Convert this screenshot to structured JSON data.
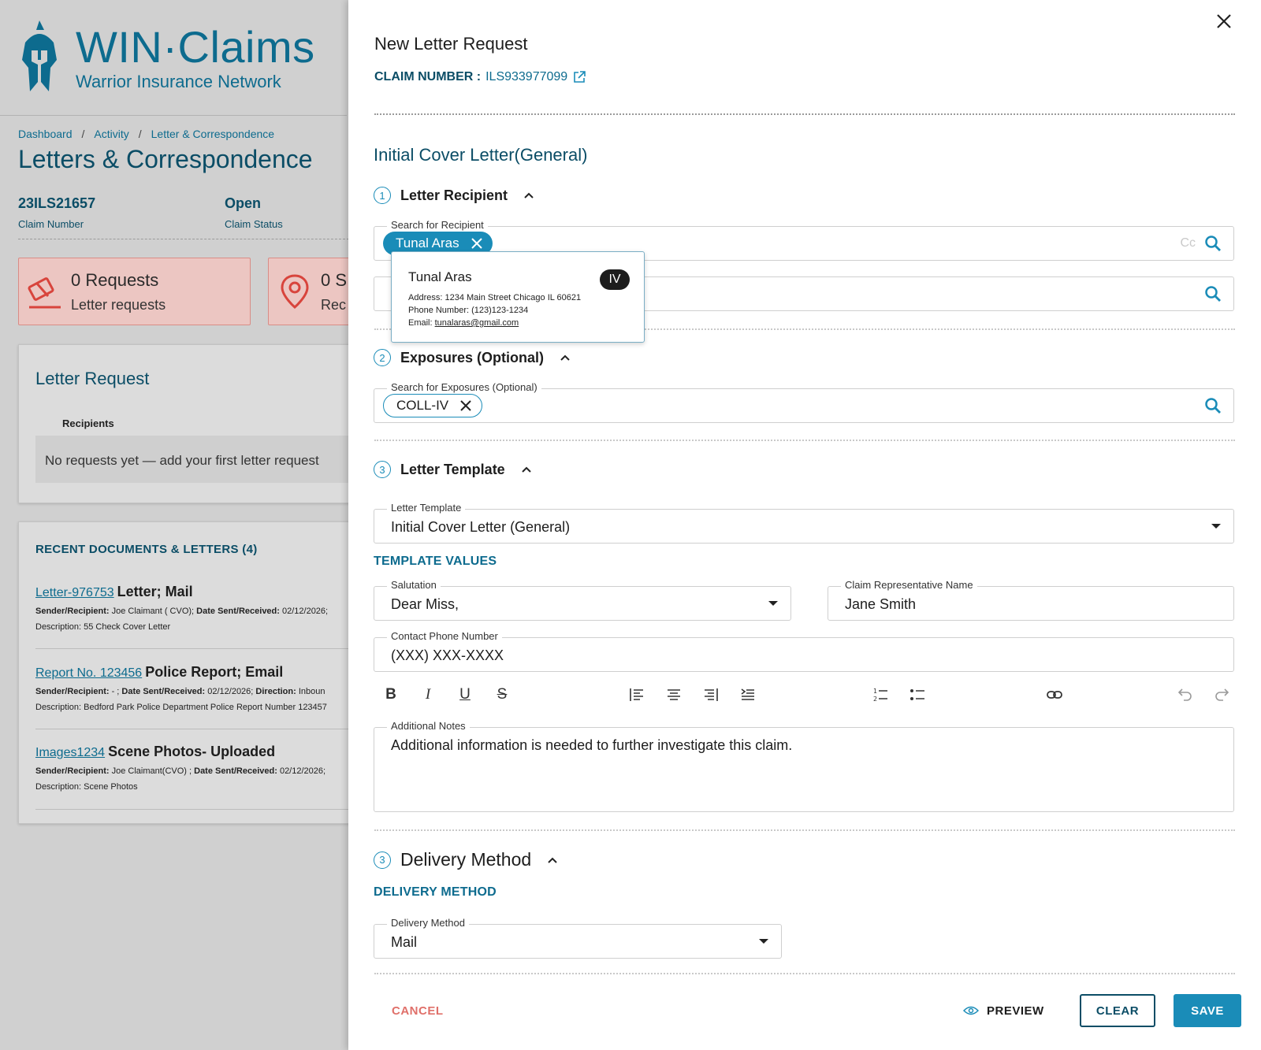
{
  "brand": {
    "title": "WIN·Claims",
    "subtitle": "Warrior Insurance Network"
  },
  "breadcrumb": [
    "Dashboard",
    "Activity",
    "Letter & Correspondence"
  ],
  "page_title": "Letters & Correspondence",
  "claim": {
    "number": "23ILS21657",
    "number_label": "Claim Number",
    "status": "Open",
    "status_label": "Claim Status"
  },
  "stats": [
    {
      "value": "0 Requests",
      "label": "Letter requests"
    },
    {
      "value": "0 S",
      "label": "Rec"
    }
  ],
  "letter_request": {
    "title": "Letter Request",
    "recipients_header": "Recipients",
    "empty_text": "No requests yet — add your first letter request"
  },
  "recent_docs": {
    "title": "RECENT DOCUMENTS & LETTERS (4)",
    "items": [
      {
        "link": "Letter-976753",
        "type": "Letter; Mail",
        "line1_k1": "Sender/Recipient:",
        "line1_v1": " Joe Claimant ( CVO);  ",
        "line1_k2": "Date Sent/Received:",
        "line1_v2": " 02/12/2026;",
        "line2": "Description: 55 Check Cover Letter"
      },
      {
        "link": "Report No. 123456",
        "type": "Police Report; Email",
        "line1_k1": "Sender/Recipient:",
        "line1_v1": " - ;  ",
        "line1_k2": "Date Sent/Received:",
        "line1_v2": " 02/12/2026;  ",
        "line1_k3": "Direction:",
        "line1_v3": " Inboun",
        "line2": "Description: Bedford Park Police Department Police Report Number 123457"
      },
      {
        "link": "Images1234",
        "type": "Scene Photos- Uploaded",
        "line1_k1": "Sender/Recipient:",
        "line1_v1": " Joe Claimant(CVO) ;  ",
        "line1_k2": "Date Sent/Received:",
        "line1_v2": " 02/12/2026;",
        "line2": "Description: Scene Photos"
      }
    ]
  },
  "drawer": {
    "title": "New Letter Request",
    "claim_label": "CLAIM NUMBER :",
    "claim_number": "ILS933977099",
    "section_title": "Initial Cover Letter(General)",
    "steps": {
      "recipient": {
        "num": "1",
        "label": "Letter Recipient"
      },
      "exposures": {
        "num": "2",
        "label": "Exposures (Optional)"
      },
      "template": {
        "num": "3",
        "label": "Letter Template"
      },
      "delivery": {
        "num": "3",
        "label": "Delivery Method"
      }
    },
    "recipient_field": {
      "label": "Search for Recipient",
      "chip": "Tunal Aras",
      "cc": "Cc"
    },
    "popup": {
      "name": "Tunal Aras",
      "badge": "IV",
      "address": "Address: 1234 Main Street Chicago IL 60621",
      "phone": "Phone Number: (123)123-1234",
      "email_label": "Email: ",
      "email": "tunalaras@gmail.com"
    },
    "exposure_field": {
      "label": "Search for Exposures (Optional)",
      "chip": "COLL-IV"
    },
    "template_field": {
      "label": "Letter Template",
      "value": "Initial Cover Letter (General)"
    },
    "template_values_heading": "TEMPLATE VALUES",
    "salutation": {
      "label": "Salutation",
      "value": "Dear Miss,"
    },
    "rep_name": {
      "label": "Claim Representative Name",
      "value": "Jane Smith"
    },
    "phone": {
      "label": "Contact Phone Number",
      "value": "(XXX) XXX-XXXX"
    },
    "notes": {
      "label": "Additional Notes",
      "value": "Additional information is needed to further investigate this claim."
    },
    "delivery_heading": "DELIVERY METHOD",
    "delivery_field": {
      "label": "Delivery Method",
      "value": "Mail"
    },
    "buttons": {
      "cancel": "CANCEL",
      "preview": "PREVIEW",
      "clear": "CLEAR",
      "save": "SAVE"
    }
  },
  "colors": {
    "brand": "#0d6b8e",
    "accent": "#1a8cb8",
    "heading": "#0b4d66",
    "danger": "#e0706a"
  }
}
